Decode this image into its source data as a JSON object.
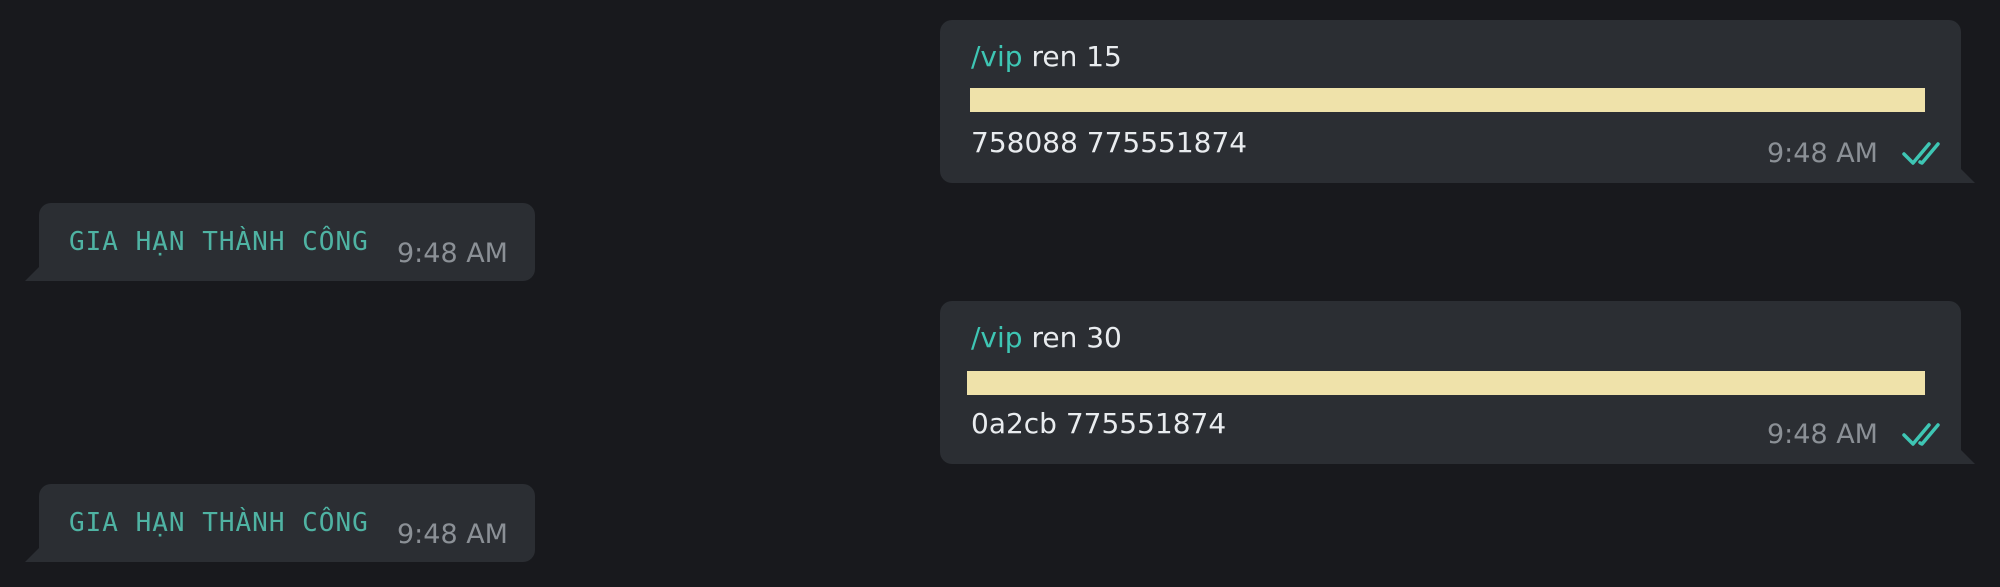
{
  "messages": [
    {
      "direction": "outgoing",
      "command": "/vip",
      "args": " ren 15",
      "redacted": true,
      "tail_text": "758088 775551874",
      "time": "9:48 AM",
      "status": "read-double-check"
    },
    {
      "direction": "incoming",
      "text": "GIA HẠN THÀNH CÔNG",
      "time": "9:48 AM"
    },
    {
      "direction": "outgoing",
      "command": "/vip",
      "args": " ren 30",
      "redacted": true,
      "tail_text": "0a2cb 775551874",
      "time": "9:48 AM",
      "status": "read-double-check"
    },
    {
      "direction": "incoming",
      "text": "GIA HẠN THÀNH CÔNG",
      "time": "9:48 AM"
    }
  ],
  "colors": {
    "background": "#18191d",
    "bubble": "#2b2e33",
    "command": "#3ec6b4",
    "reply_text": "#4fb3a3",
    "timestamp": "#8b9096",
    "redaction": "#efe2aa",
    "read_ticks": "#3ec6b4"
  }
}
